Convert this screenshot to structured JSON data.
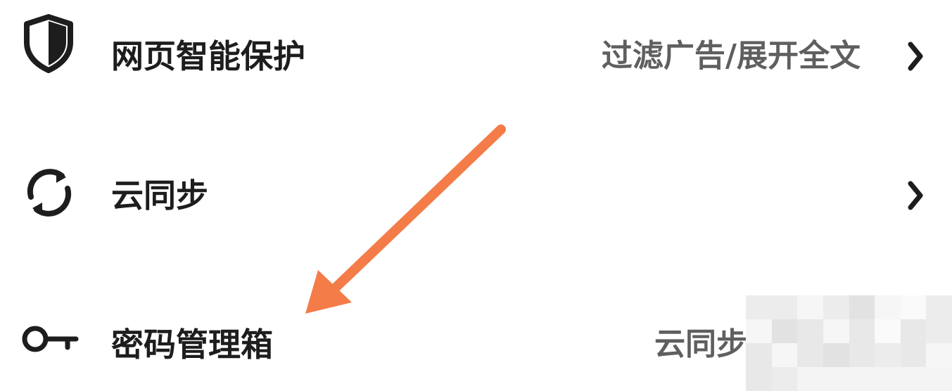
{
  "settings": {
    "items": [
      {
        "icon": "shield-icon",
        "label": "网页智能保护",
        "value": "过滤广告/展开全文",
        "chevron": true
      },
      {
        "icon": "sync-icon",
        "label": "云同步",
        "value": "",
        "chevron": true
      },
      {
        "icon": "key-icon",
        "label": "密码管理箱",
        "value": "云同步",
        "chevron": false
      }
    ]
  },
  "annotation": {
    "icon": "arrow-annotation-icon",
    "color": "#f47c48"
  },
  "colors": {
    "title": "#1d1d1d",
    "value": "#5f5f5f",
    "background": "#ffffff"
  }
}
